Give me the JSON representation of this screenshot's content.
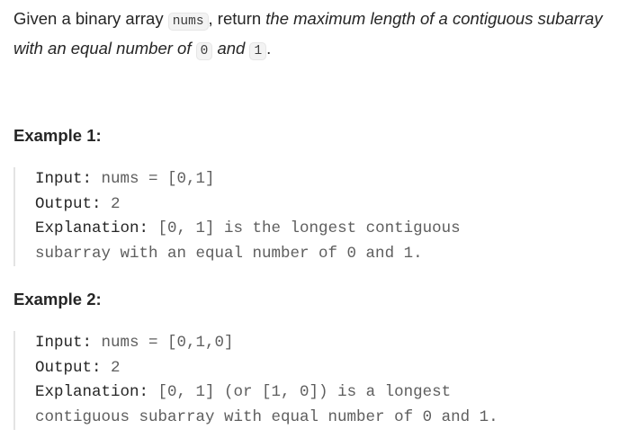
{
  "problem": {
    "text_1": "Given a binary array ",
    "code_nums": "nums",
    "text_2": ", return ",
    "emph_1": "the maximum length of a contiguous subarray with an equal number of ",
    "code_0": "0",
    "emph_2": " and ",
    "code_1": "1",
    "text_3": "."
  },
  "examples": [
    {
      "heading": "Example 1:",
      "input_label": "Input:",
      "input_value": " nums = [0,1]",
      "output_label": "Output:",
      "output_value": " 2",
      "explanation_label": "Explanation:",
      "explanation_line1": " [0, 1] is the longest contiguous",
      "explanation_line2": "subarray with an equal number of 0 and 1."
    },
    {
      "heading": "Example 2:",
      "input_label": "Input:",
      "input_value": " nums = [0,1,0]",
      "output_label": "Output:",
      "output_value": " 2",
      "explanation_label": "Explanation:",
      "explanation_line1": " [0, 1] (or [1, 0]) is a longest",
      "explanation_line2": "contiguous subarray with equal number of 0 and 1."
    }
  ]
}
